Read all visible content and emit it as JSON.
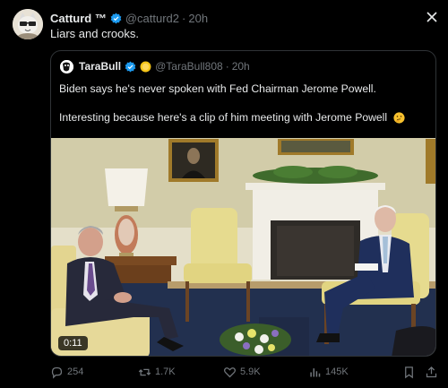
{
  "tweet": {
    "name": "Catturd ™",
    "handle": "@catturd2",
    "dot": "·",
    "time": "20h",
    "text": "Liars and crooks."
  },
  "quote": {
    "name": "TaraBull",
    "handle": "@TaraBull808",
    "dot": "·",
    "time": "20h",
    "text1": "Biden says he's never spoken with Fed Chairman Jerome Powell.",
    "text2": "Interesting because here's a clip of him meeting with Jerome Powell",
    "video_time": "0:11"
  },
  "actions": {
    "replies": "254",
    "reposts": "1.7K",
    "likes": "5.9K",
    "views": "145K"
  },
  "icons": {
    "verified": "verified-badge-icon",
    "gold": "gold-badge-icon",
    "emoji": "thinking-face-emoji",
    "close": "close-icon"
  },
  "colors": {
    "background": "#000000",
    "text": "#e7e9ea",
    "muted": "#71767b",
    "verified": "#1d9bf0",
    "gold": "#f5c518"
  }
}
